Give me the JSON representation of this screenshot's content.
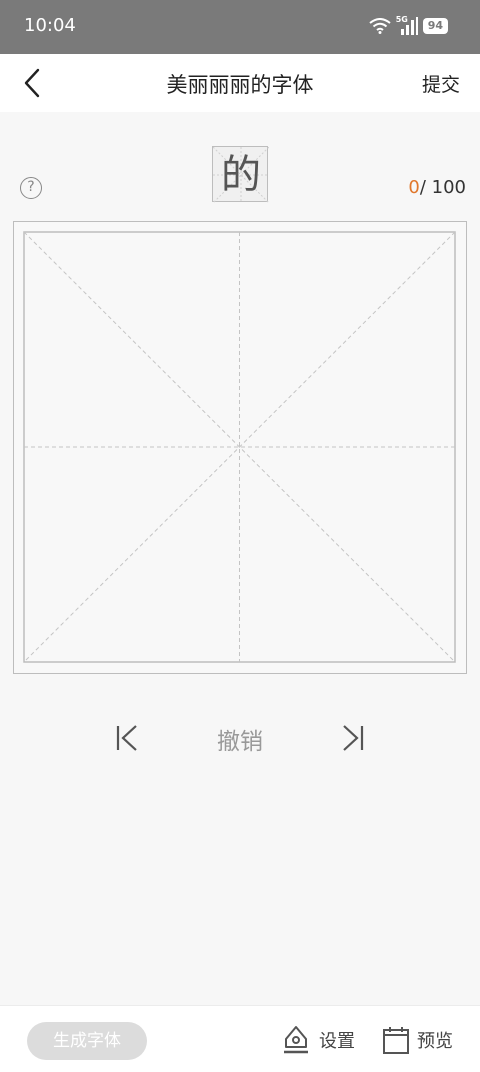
{
  "status_bar": {
    "time": "10:04",
    "network": "5G",
    "battery": "94"
  },
  "header": {
    "title": "美丽丽丽的字体",
    "submit_label": "提交",
    "back_icon": "chevron-left-icon"
  },
  "practice": {
    "help_glyph": "?",
    "target_character": "的",
    "progress_done": "0",
    "progress_total": "/ 100"
  },
  "controls": {
    "undo_label": "撤销",
    "prev_icon": "skip-previous-icon",
    "next_icon": "skip-next-icon"
  },
  "bottom_bar": {
    "generate_label": "生成字体",
    "settings_label": "设置",
    "preview_label": "预览"
  },
  "colors": {
    "status_bar": "#7a7a7a",
    "accent": "#e0772c",
    "disabled_button": "#dcdcdc",
    "grid_line": "#bdbdbd"
  }
}
